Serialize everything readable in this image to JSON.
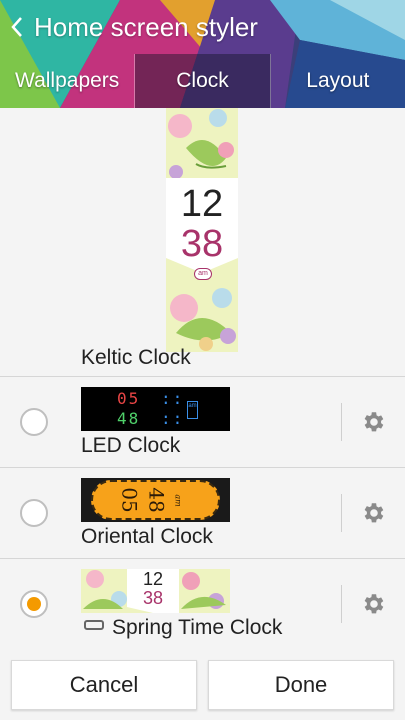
{
  "header": {
    "title": "Home screen styler",
    "tabs": [
      {
        "label": "Wallpapers"
      },
      {
        "label": "Clock"
      },
      {
        "label": "Layout"
      }
    ]
  },
  "preview": {
    "hour": "12",
    "minute": "38",
    "ampm": "am"
  },
  "clocks": [
    {
      "label": "Keltic Clock"
    },
    {
      "label": "LED Clock",
      "selected": false,
      "thumb": {
        "digits": [
          "05",
          "48"
        ],
        "ampm": "am"
      }
    },
    {
      "label": "Oriental Clock",
      "selected": false,
      "thumb": {
        "digits": [
          "05",
          "48"
        ],
        "ampm": "am"
      }
    },
    {
      "label": "Spring Time Clock",
      "selected": true,
      "thumb": {
        "digits": [
          "12",
          "38"
        ]
      }
    }
  ],
  "buttons": {
    "cancel": "Cancel",
    "done": "Done"
  },
  "colors": {
    "accent": "#f49a00",
    "oriental": "#f7a21a",
    "led_bg": "#000000"
  }
}
